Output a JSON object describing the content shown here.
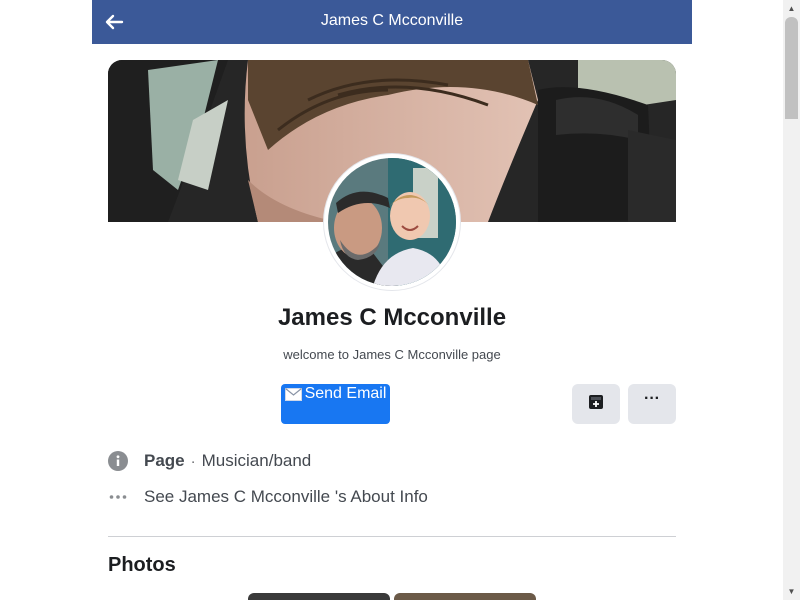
{
  "header": {
    "title": "James C Mcconville",
    "back_icon": "arrow-left-icon",
    "background_color": "#3b5998"
  },
  "profile": {
    "name": "James C Mcconville",
    "tagline": "welcome to James C Mcconville page"
  },
  "actions": {
    "send_email_label": "Send Email",
    "send_email_icon": "envelope-icon",
    "save_icon": "save-icon",
    "more_label": "···",
    "primary_color": "#1877f2"
  },
  "info": {
    "page_label": "Page",
    "separator": "·",
    "category": "Musician/band",
    "about_link": "See James C Mcconville 's About Info",
    "info_icon": "info-icon",
    "more_icon": "more-dots-icon"
  },
  "photos": {
    "title": "Photos"
  }
}
